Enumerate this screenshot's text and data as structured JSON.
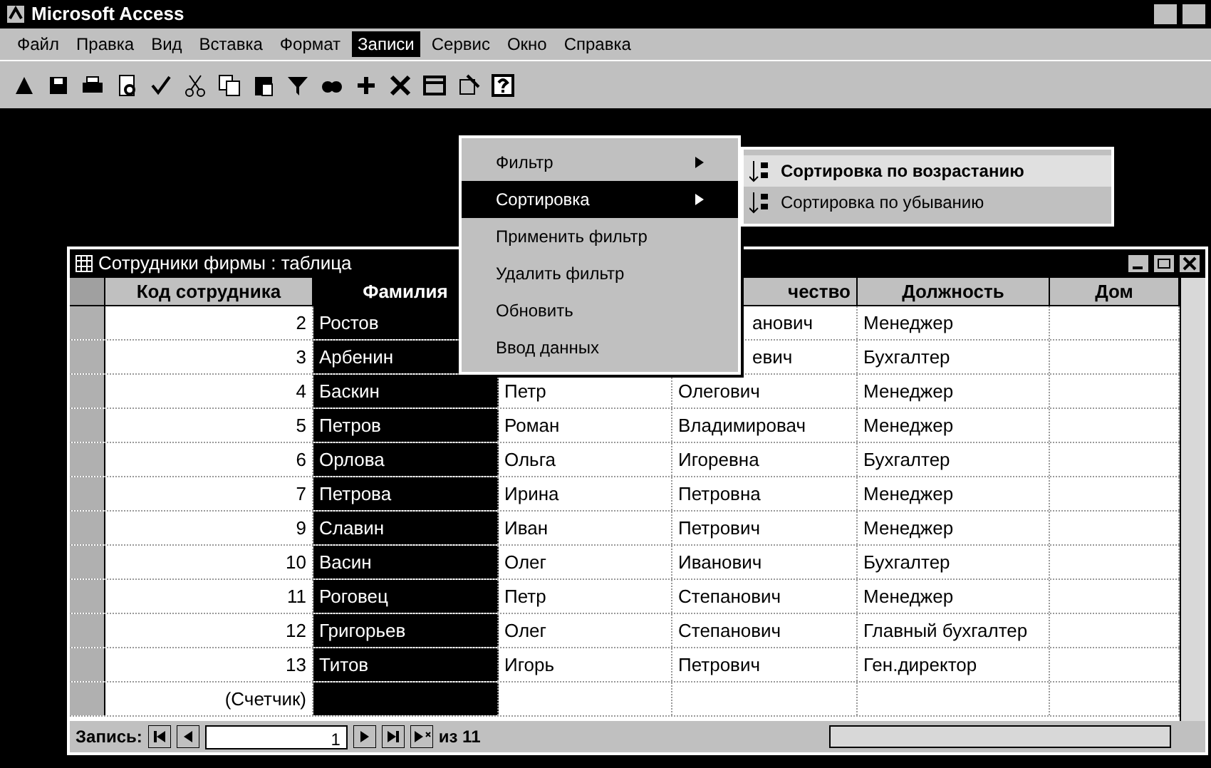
{
  "window": {
    "title": "Microsoft Access"
  },
  "menu_bar": [
    {
      "label": "Файл",
      "selected": false
    },
    {
      "label": "Правка",
      "selected": false
    },
    {
      "label": "Вид",
      "selected": false
    },
    {
      "label": "Вставка",
      "selected": false
    },
    {
      "label": "Формат",
      "selected": false
    },
    {
      "label": "Записи",
      "selected": true
    },
    {
      "label": "Сервис",
      "selected": false
    },
    {
      "label": "Окно",
      "selected": false
    },
    {
      "label": "Справка",
      "selected": false
    }
  ],
  "records_menu": [
    {
      "label": "Фильтр",
      "submenu": true,
      "selected": false
    },
    {
      "label": "Сортировка",
      "submenu": true,
      "selected": true
    },
    {
      "label": "Применить фильтр",
      "submenu": false,
      "selected": false
    },
    {
      "label": "Удалить фильтр",
      "submenu": false,
      "selected": false
    },
    {
      "label": "Обновить",
      "submenu": false,
      "selected": false
    },
    {
      "label": "Ввод данных",
      "submenu": false,
      "selected": false
    }
  ],
  "sort_submenu": [
    {
      "label": "Сортировка по возрастанию",
      "selected": true
    },
    {
      "label": "Сортировка по убыванию",
      "selected": false
    }
  ],
  "table_window": {
    "title": "Сотрудники фирмы : таблица",
    "columns": [
      {
        "label": "Код сотрудника",
        "selected": false
      },
      {
        "label": "Фамилия",
        "selected": true
      },
      {
        "label": "чество",
        "selected": false,
        "covered": true
      },
      {
        "label": "Должность",
        "selected": false
      },
      {
        "label": "Дом",
        "selected": false
      }
    ],
    "rows": [
      {
        "code": "2",
        "surname": "Ростов",
        "patronymic": "анович",
        "position": "Менеджер",
        "covered": true
      },
      {
        "code": "3",
        "surname": "Арбенин",
        "patronymic": "евич",
        "position": "Бухгалтер",
        "covered": true
      },
      {
        "code": "4",
        "surname": "Баскин",
        "name": "Петр",
        "patronymic": "Олегович",
        "position": "Менеджер"
      },
      {
        "code": "5",
        "surname": "Петров",
        "name": "Роман",
        "patronymic": "Владимировач",
        "position": "Менеджер"
      },
      {
        "code": "6",
        "surname": "Орлова",
        "name": "Ольга",
        "patronymic": "Игоревна",
        "position": "Бухгалтер"
      },
      {
        "code": "7",
        "surname": "Петрова",
        "name": "Ирина",
        "patronymic": "Петровна",
        "position": "Менеджер"
      },
      {
        "code": "9",
        "surname": "Славин",
        "name": "Иван",
        "patronymic": "Петрович",
        "position": "Менеджер"
      },
      {
        "code": "10",
        "surname": "Васин",
        "name": "Олег",
        "patronymic": "Иванович",
        "position": "Бухгалтер"
      },
      {
        "code": "11",
        "surname": "Роговец",
        "name": "Петр",
        "patronymic": "Степанович",
        "position": "Менеджер"
      },
      {
        "code": "12",
        "surname": "Григорьев",
        "name": "Олег",
        "patronymic": "Степанович",
        "position": "Главный бухгалтер"
      },
      {
        "code": "13",
        "surname": "Титов",
        "name": "Игорь",
        "patronymic": "Петрович",
        "position": "Ген.директор"
      }
    ],
    "new_row": {
      "code": "(Счетчик)"
    },
    "navigation": {
      "label": "Запись:",
      "current": "1",
      "total": "из 11"
    }
  }
}
